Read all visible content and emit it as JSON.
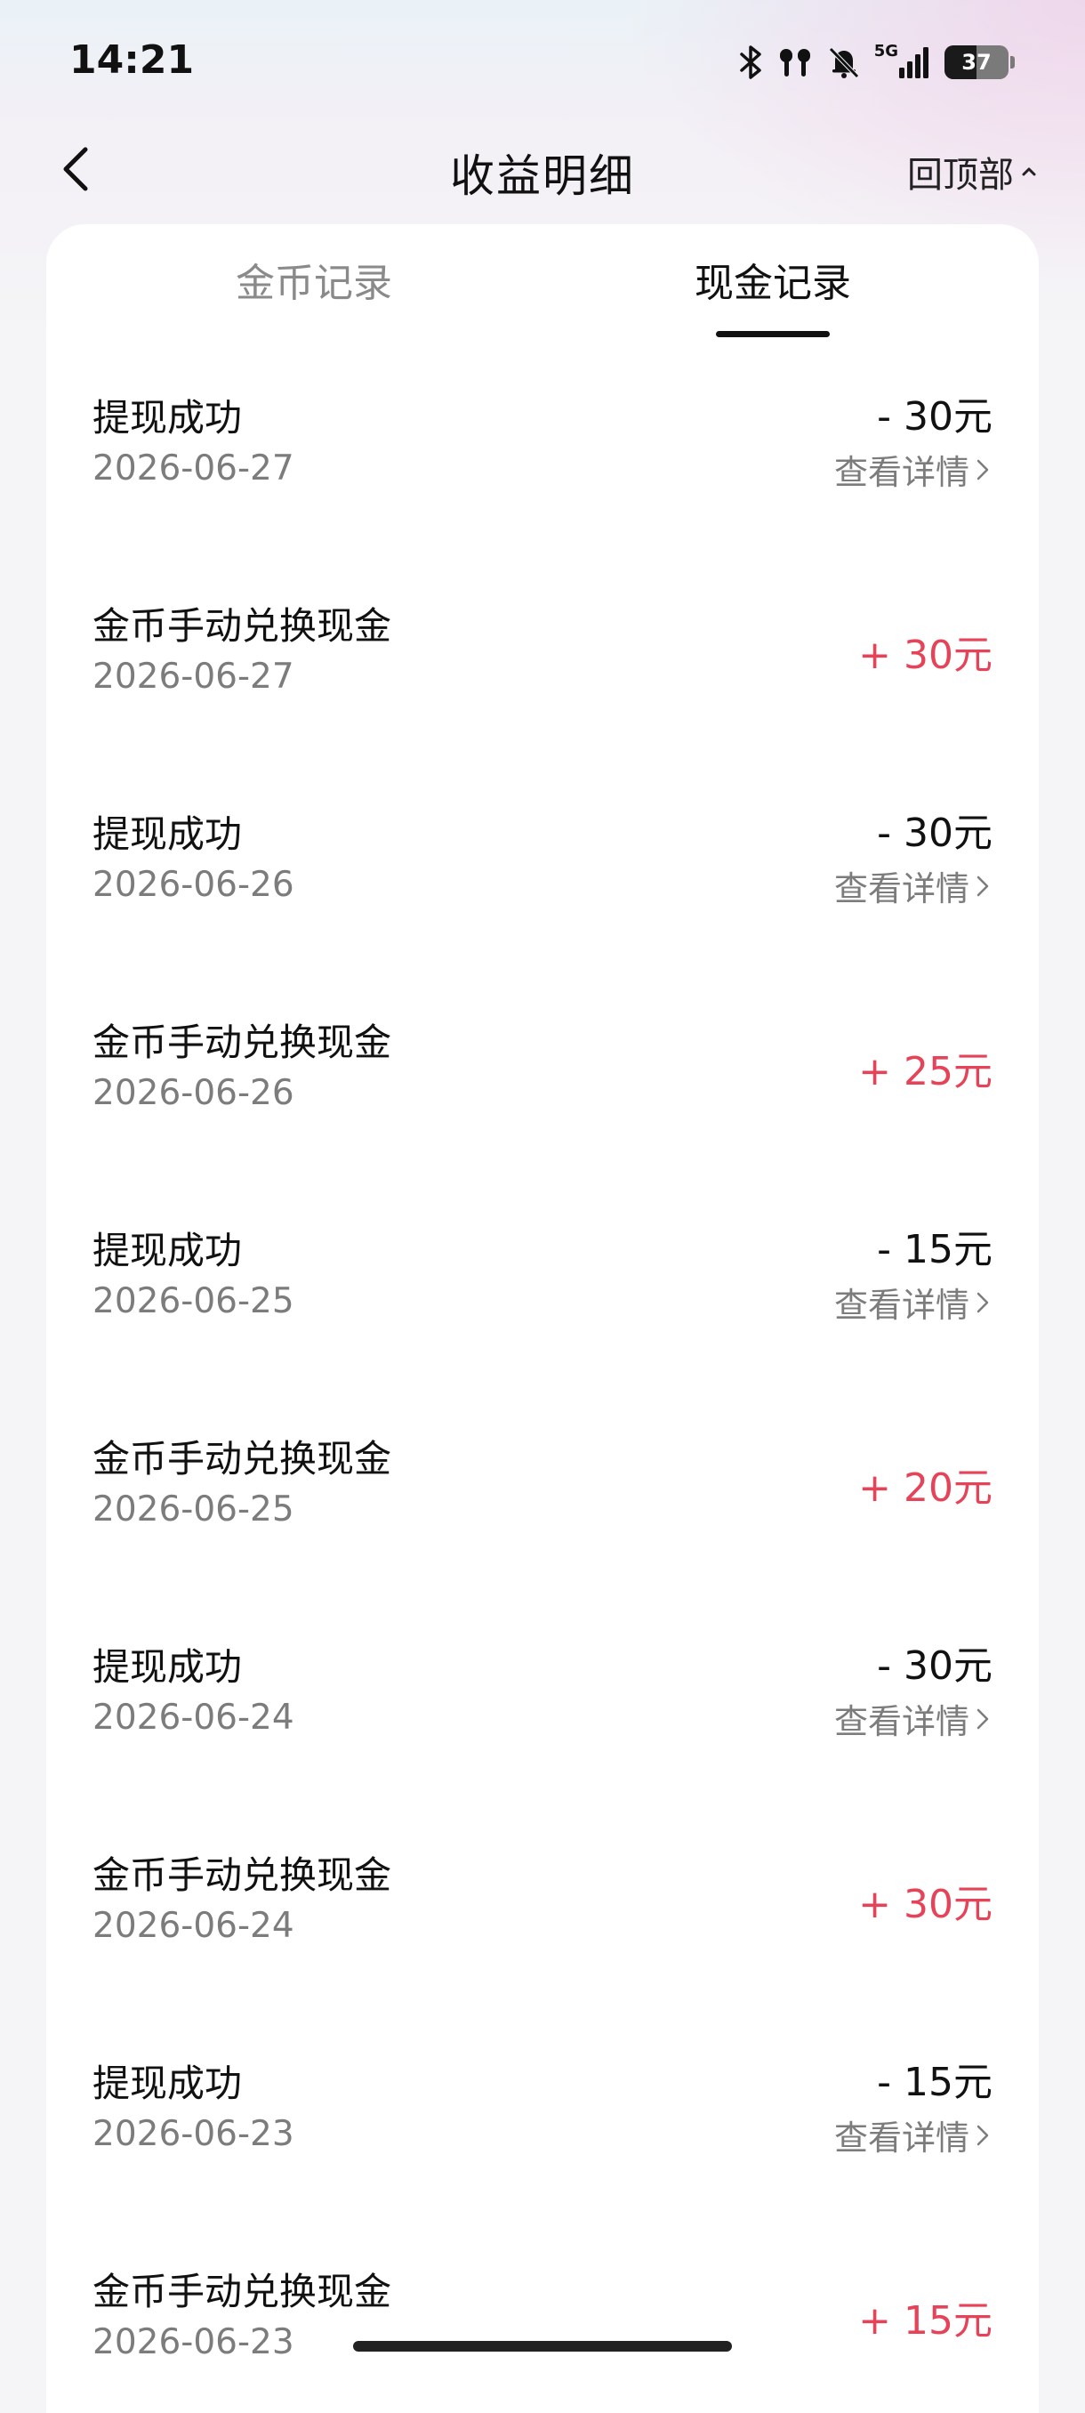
{
  "status_bar": {
    "time": "14:21",
    "network": "5G",
    "battery": "37",
    "icons": [
      "bluetooth-icon",
      "earbuds-icon",
      "mute-bell-icon",
      "signal-icon",
      "battery-icon"
    ]
  },
  "header": {
    "title": "收益明细",
    "back_icon": "chevron-left-icon",
    "top_link": "回顶部"
  },
  "tabs": [
    {
      "label": "金币记录",
      "active": false
    },
    {
      "label": "现金记录",
      "active": true
    }
  ],
  "colors": {
    "positive_amount": "#e64359",
    "text_primary": "#111111",
    "text_secondary": "#7c7c7c"
  },
  "records": [
    {
      "title": "提现成功",
      "date": "2026-06-27",
      "amount": "- 30元",
      "detail": "查看详情"
    },
    {
      "title": "金币手动兑换现金",
      "date": "2026-06-27",
      "amount": "+ 30元"
    },
    {
      "title": "提现成功",
      "date": "2026-06-26",
      "amount": "- 30元",
      "detail": "查看详情"
    },
    {
      "title": "金币手动兑换现金",
      "date": "2026-06-26",
      "amount": "+ 25元"
    },
    {
      "title": "提现成功",
      "date": "2026-06-25",
      "amount": "- 15元",
      "detail": "查看详情"
    },
    {
      "title": "金币手动兑换现金",
      "date": "2026-06-25",
      "amount": "+ 20元"
    },
    {
      "title": "提现成功",
      "date": "2026-06-24",
      "amount": "- 30元",
      "detail": "查看详情"
    },
    {
      "title": "金币手动兑换现金",
      "date": "2026-06-24",
      "amount": "+ 30元"
    },
    {
      "title": "提现成功",
      "date": "2026-06-23",
      "amount": "- 15元",
      "detail": "查看详情"
    },
    {
      "title": "金币手动兑换现金",
      "date": "2026-06-23",
      "amount": "+ 15元"
    }
  ]
}
